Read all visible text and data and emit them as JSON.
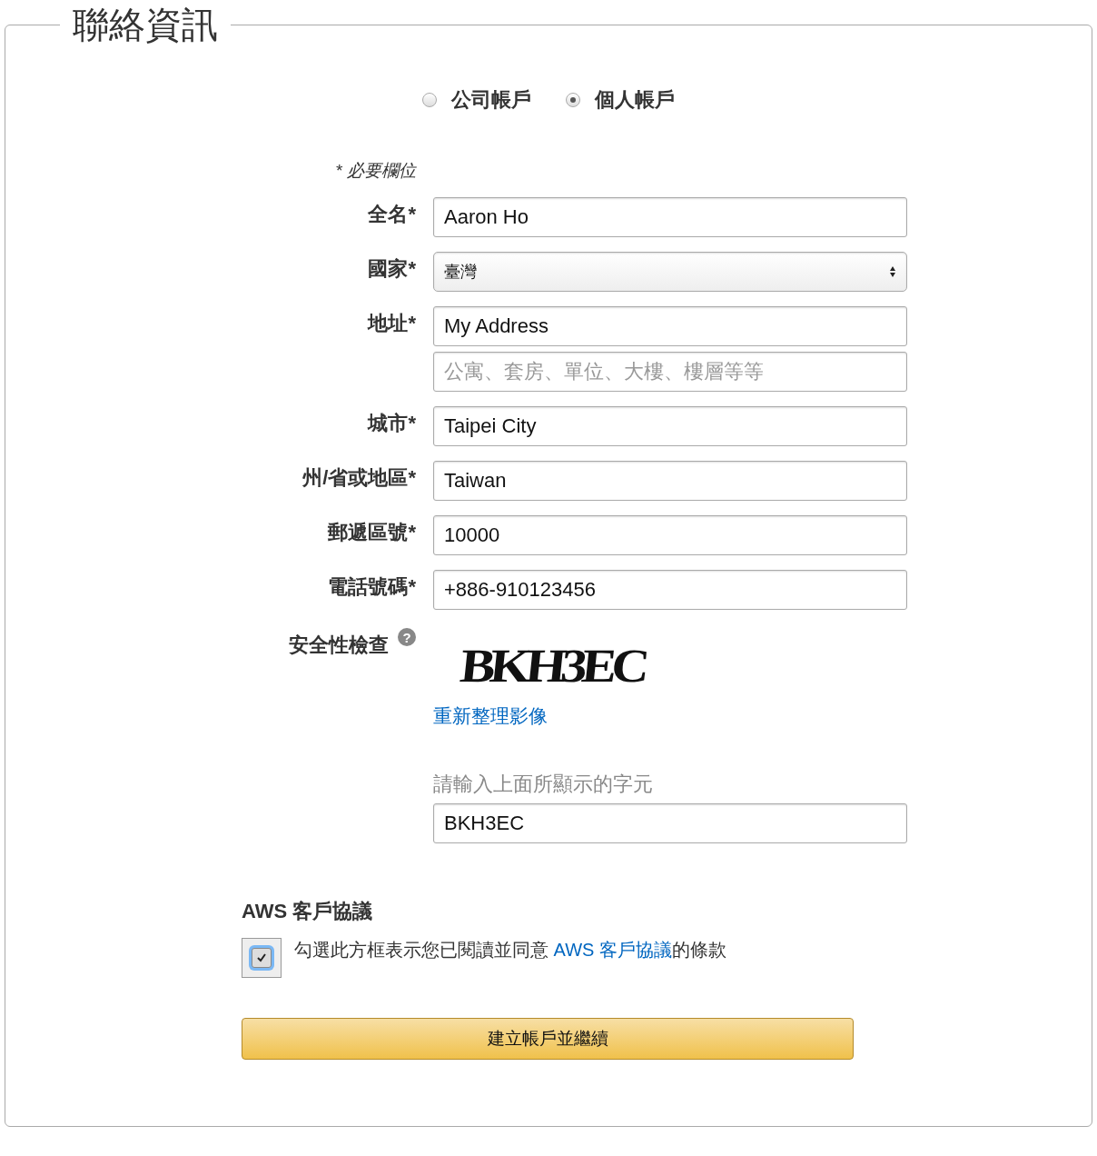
{
  "title": "聯絡資訊",
  "account_types": [
    {
      "label": "公司帳戶",
      "selected": false
    },
    {
      "label": "個人帳戶",
      "selected": true
    }
  ],
  "required_note": "* 必要欄位",
  "fields": [
    {
      "label": "全名*",
      "kind": "text",
      "value": "Aaron Ho"
    },
    {
      "label": "國家*",
      "kind": "select",
      "value": "臺灣"
    },
    {
      "label": "地址*",
      "kind": "text",
      "value": "My Address"
    },
    {
      "kind": "text",
      "placeholder": "公寓、套房、單位、大樓、樓層等等"
    },
    {
      "label": "城市*",
      "kind": "text",
      "value": "Taipei City"
    },
    {
      "label": "州/省或地區*",
      "kind": "text",
      "value": "Taiwan"
    },
    {
      "label": "郵遞區號*",
      "kind": "text",
      "value": "10000"
    },
    {
      "label": "電話號碼*",
      "kind": "text",
      "value": "+886-910123456"
    }
  ],
  "security": {
    "label": "安全性檢查",
    "help": "?",
    "captcha": "BKH3EC",
    "refresh_link": "重新整理影像",
    "prompt": "請輸入上面所顯示的字元",
    "value": "BKH3EC"
  },
  "agreement": {
    "heading": "AWS 客戶協議",
    "checked": true,
    "text_before": "勾選此方框表示您已閱讀並同意 ",
    "link": "AWS 客戶協議",
    "text_after": "的條款"
  },
  "submit": "建立帳戶並繼續"
}
